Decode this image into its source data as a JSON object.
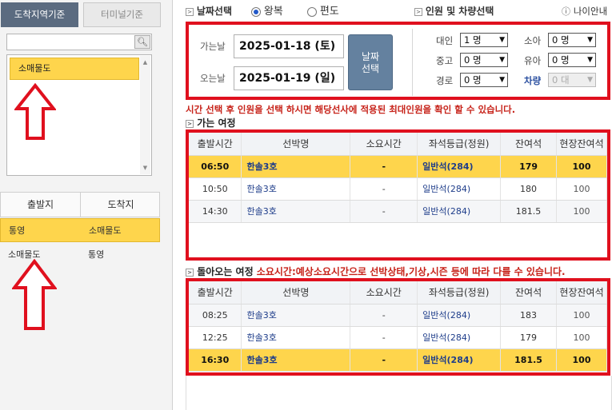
{
  "left": {
    "tabs": [
      {
        "label": "도착지역기준"
      },
      {
        "label": "터미널기준"
      }
    ],
    "search": {
      "value": "",
      "placeholder": "",
      "icon": "search-icon"
    },
    "regions": [
      {
        "label": "소매물도"
      }
    ],
    "route_headers": {
      "departure": "출발지",
      "arrival": "도착지"
    },
    "routes": [
      {
        "departure": "통영",
        "arrival": "소매물도",
        "selected": true
      },
      {
        "departure": "소매물도",
        "arrival": "통영",
        "selected": false
      }
    ]
  },
  "topbar": {
    "date_select": "날짜선택",
    "round_trip": "왕복",
    "one_way": "편도",
    "pax_select": "인원 및 차량선택",
    "guide": "나이안내"
  },
  "dates": {
    "go_label": "가는날",
    "go_value": "2025-01-18 (토)",
    "return_label": "오는날",
    "return_value": "2025-01-19 (일)",
    "button": "날짜\n선택"
  },
  "passengers": {
    "adult_label": "대인",
    "adult_value": "1 명",
    "child_label": "소아",
    "child_value": "0 명",
    "teen_label": "중고",
    "teen_value": "0 명",
    "infant_label": "유아",
    "infant_value": "0 명",
    "senior_label": "경로",
    "senior_value": "0 명",
    "vehicle_label": "차량",
    "vehicle_value": "0 대"
  },
  "notice": "시간 선택 후 인원을 선택 하시면 해당선사에 적용된 최대인원을 확인 할 수 있습니다.",
  "outbound": {
    "title": "가는 여정",
    "headers": [
      "출발시간",
      "선박명",
      "소요시간",
      "좌석등급(정원)",
      "잔여석",
      "현장잔여석"
    ],
    "rows": [
      {
        "time": "06:50",
        "ship": "한솔3호",
        "duration": "-",
        "grade": "일반석(284)",
        "remaining": "179",
        "onsite": "100",
        "selected": true
      },
      {
        "time": "10:50",
        "ship": "한솔3호",
        "duration": "-",
        "grade": "일반석(284)",
        "remaining": "180",
        "onsite": "100",
        "selected": false
      },
      {
        "time": "14:30",
        "ship": "한솔3호",
        "duration": "-",
        "grade": "일반석(284)",
        "remaining": "181.5",
        "onsite": "100",
        "selected": false
      }
    ]
  },
  "inbound": {
    "title": "돌아오는 여정",
    "note": "소요시간:예상소요시간으로 선박상태,기상,시즌 등에 따라 다를 수 있습니다.",
    "headers": [
      "출발시간",
      "선박명",
      "소요시간",
      "좌석등급(정원)",
      "잔여석",
      "현장잔여석"
    ],
    "rows": [
      {
        "time": "08:25",
        "ship": "한솔3호",
        "duration": "-",
        "grade": "일반석(284)",
        "remaining": "183",
        "onsite": "100",
        "selected": false
      },
      {
        "time": "12:25",
        "ship": "한솔3호",
        "duration": "-",
        "grade": "일반석(284)",
        "remaining": "179",
        "onsite": "100",
        "selected": false
      },
      {
        "time": "16:30",
        "ship": "한솔3호",
        "duration": "-",
        "grade": "일반석(284)",
        "remaining": "181.5",
        "onsite": "100",
        "selected": true
      }
    ]
  },
  "colors": {
    "highlight": "#fed54c",
    "annotation_red": "#e0101e",
    "tab_active": "#5b6b80",
    "button": "#64819f"
  }
}
